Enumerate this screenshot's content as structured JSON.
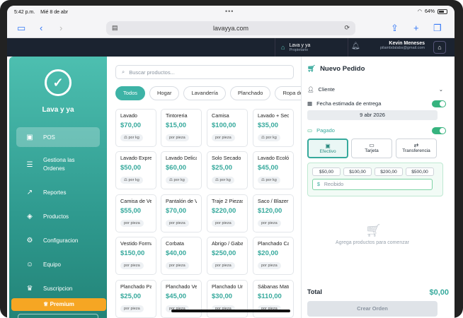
{
  "status": {
    "time": "5:42 p.m.",
    "date": "Mié 8 de abr",
    "battery": "64%"
  },
  "browser": {
    "url": "lavayya.com"
  },
  "header": {
    "business_name": "Lava y ya",
    "business_role": "Propietario",
    "user_name": "Kevin Meneses",
    "user_email": "pilambdalabs@gmail.com"
  },
  "sidebar": {
    "brand": "Lava y ya",
    "items": [
      {
        "label": "POS",
        "icon": "store-icon"
      },
      {
        "label": "Gestiona las Ordenes",
        "icon": "orders-icon"
      },
      {
        "label": "Reportes",
        "icon": "chart-icon"
      },
      {
        "label": "Productos",
        "icon": "tag-icon"
      },
      {
        "label": "Configuracion",
        "icon": "gear-icon"
      },
      {
        "label": "Equipo",
        "icon": "team-icon"
      },
      {
        "label": "Suscripcion",
        "icon": "crown-icon"
      }
    ],
    "premium": "Premium"
  },
  "products": {
    "search_placeholder": "Buscar productos...",
    "categories": [
      "Todos",
      "Hogar",
      "Lavandería",
      "Planchado",
      "Ropa de Cama"
    ],
    "items": [
      {
        "name": "Lavado",
        "price": "$70,00",
        "unit": "por kg"
      },
      {
        "name": "Tintoreria",
        "price": "$15,00",
        "unit": "por pieza"
      },
      {
        "name": "Camisa",
        "price": "$100,00",
        "unit": "por pieza"
      },
      {
        "name": "Lavado + Secado",
        "price": "$35,00",
        "unit": "por kg"
      },
      {
        "name": "Lavado Express",
        "price": "$50,00",
        "unit": "por kg"
      },
      {
        "name": "Lavado Delicado",
        "price": "$60,00",
        "unit": "por kg"
      },
      {
        "name": "Solo Secado",
        "price": "$25,00",
        "unit": "por kg"
      },
      {
        "name": "Lavado Ecológico",
        "price": "$45,00",
        "unit": "por kg"
      },
      {
        "name": "Camisa de Vestir",
        "price": "$55,00",
        "unit": "por pieza"
      },
      {
        "name": "Pantalón de Vestir",
        "price": "$70,00",
        "unit": "por pieza"
      },
      {
        "name": "Traje 2 Piezas",
        "price": "$220,00",
        "unit": "por pieza"
      },
      {
        "name": "Saco / Blazer",
        "price": "$120,00",
        "unit": "por pieza"
      },
      {
        "name": "Vestido Formal",
        "price": "$150,00",
        "unit": "por pieza"
      },
      {
        "name": "Corbata",
        "price": "$40,00",
        "unit": "por pieza"
      },
      {
        "name": "Abrigo / Gabardina",
        "price": "$250,00",
        "unit": "por pieza"
      },
      {
        "name": "Planchado Camisa",
        "price": "$20,00",
        "unit": "por pieza"
      },
      {
        "name": "Planchado Pantalón",
        "price": "$25,00",
        "unit": "por pieza"
      },
      {
        "name": "Planchado Vestido",
        "price": "$45,00",
        "unit": "por pieza"
      },
      {
        "name": "Planchado Uniforme",
        "price": "$30,00",
        "unit": "por pieza"
      },
      {
        "name": "Sábanas Matrimonial",
        "price": "$110,00",
        "unit": "por pieza"
      }
    ]
  },
  "order": {
    "title": "Nuevo Pedido",
    "client_label": "Cliente",
    "date_label": "Fecha estimada de entrega",
    "date_value": "9 abr 2026",
    "paid_label": "Pagado",
    "payment_methods": [
      "Efectivo",
      "Tarjeta",
      "Transferencia"
    ],
    "amounts": [
      "$50,00",
      "$100,00",
      "$200,00",
      "$500,00"
    ],
    "received_placeholder": "Recibido",
    "currency_symbol": "$",
    "empty_text": "Agrega productos para comenzar",
    "total_label": "Total",
    "total_value": "$0,00",
    "create_label": "Crear Orden"
  }
}
